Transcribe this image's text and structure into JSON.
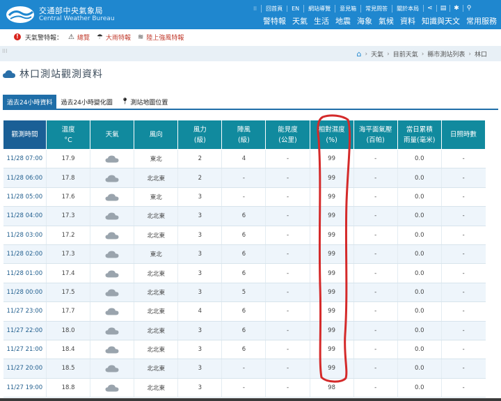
{
  "header": {
    "org_name_zh": "交通部中央氣象局",
    "org_name_en": "Central Weather Bureau",
    "top_links": [
      "回首頁",
      "EN",
      "網站導覽",
      "意見箱",
      "常見問答",
      "關於本局"
    ],
    "main_nav": [
      "警特報",
      "天氣",
      "生活",
      "地震",
      "海象",
      "氣候",
      "資料",
      "知識與天文",
      "常用服務"
    ]
  },
  "alerts": {
    "label": "天氣警特報：",
    "items": [
      {
        "icon": "warning-triangle-icon",
        "text": "總覽"
      },
      {
        "icon": "heavy-rain-icon",
        "text": "大雨特報"
      },
      {
        "icon": "strong-wind-icon",
        "text": "陸上強風特報"
      }
    ]
  },
  "breadcrumb": [
    "天氣",
    "目前天氣",
    "縣市測站列表",
    "林口"
  ],
  "page_title": "林口測站觀測資料",
  "tabs": [
    {
      "label": "過去24小時資料",
      "active": true
    },
    {
      "label": "過去24小時變化圖",
      "active": false
    },
    {
      "label": "測站地圖位置",
      "active": false
    }
  ],
  "table": {
    "columns": [
      [
        "觀測時間"
      ],
      [
        "溫度",
        "°C"
      ],
      [
        "天氣"
      ],
      [
        "風向"
      ],
      [
        "風力",
        "(級)"
      ],
      [
        "陣風",
        "(級)"
      ],
      [
        "能見度",
        "(公里)"
      ],
      [
        "相對濕度",
        "(%)"
      ],
      [
        "海平面氣壓",
        "(百帕)"
      ],
      [
        "當日累積",
        "雨量(毫米)"
      ],
      [
        "日照時數"
      ]
    ],
    "rows": [
      {
        "time": "11/28 07:00",
        "temp": "17.9",
        "weather": "cloudy-icon",
        "wind_dir": "東北",
        "wind": "2",
        "gust": "4",
        "vis": "-",
        "rh": "99",
        "pressure": "-",
        "rain": "0.0",
        "sun": "-"
      },
      {
        "time": "11/28 06:00",
        "temp": "17.8",
        "weather": "cloudy-icon",
        "wind_dir": "北北東",
        "wind": "2",
        "gust": "-",
        "vis": "-",
        "rh": "99",
        "pressure": "-",
        "rain": "0.0",
        "sun": "-"
      },
      {
        "time": "11/28 05:00",
        "temp": "17.6",
        "weather": "cloudy-icon",
        "wind_dir": "東北",
        "wind": "3",
        "gust": "-",
        "vis": "-",
        "rh": "99",
        "pressure": "-",
        "rain": "0.0",
        "sun": "-"
      },
      {
        "time": "11/28 04:00",
        "temp": "17.3",
        "weather": "cloudy-icon",
        "wind_dir": "北北東",
        "wind": "3",
        "gust": "6",
        "vis": "-",
        "rh": "99",
        "pressure": "-",
        "rain": "0.0",
        "sun": "-"
      },
      {
        "time": "11/28 03:00",
        "temp": "17.2",
        "weather": "cloudy-icon",
        "wind_dir": "北北東",
        "wind": "3",
        "gust": "6",
        "vis": "-",
        "rh": "99",
        "pressure": "-",
        "rain": "0.0",
        "sun": "-"
      },
      {
        "time": "11/28 02:00",
        "temp": "17.3",
        "weather": "cloudy-icon",
        "wind_dir": "東北",
        "wind": "3",
        "gust": "6",
        "vis": "-",
        "rh": "99",
        "pressure": "-",
        "rain": "0.0",
        "sun": "-"
      },
      {
        "time": "11/28 01:00",
        "temp": "17.4",
        "weather": "cloudy-icon",
        "wind_dir": "北北東",
        "wind": "3",
        "gust": "6",
        "vis": "-",
        "rh": "99",
        "pressure": "-",
        "rain": "0.0",
        "sun": "-"
      },
      {
        "time": "11/28 00:00",
        "temp": "17.5",
        "weather": "cloudy-icon",
        "wind_dir": "北北東",
        "wind": "3",
        "gust": "5",
        "vis": "-",
        "rh": "99",
        "pressure": "-",
        "rain": "0.0",
        "sun": "-"
      },
      {
        "time": "11/27 23:00",
        "temp": "17.7",
        "weather": "cloudy-icon",
        "wind_dir": "北北東",
        "wind": "4",
        "gust": "6",
        "vis": "-",
        "rh": "99",
        "pressure": "-",
        "rain": "0.0",
        "sun": "-"
      },
      {
        "time": "11/27 22:00",
        "temp": "18.0",
        "weather": "cloudy-icon",
        "wind_dir": "北北東",
        "wind": "3",
        "gust": "6",
        "vis": "-",
        "rh": "99",
        "pressure": "-",
        "rain": "0.0",
        "sun": "-"
      },
      {
        "time": "11/27 21:00",
        "temp": "18.4",
        "weather": "cloudy-icon",
        "wind_dir": "北北東",
        "wind": "3",
        "gust": "6",
        "vis": "-",
        "rh": "99",
        "pressure": "-",
        "rain": "0.0",
        "sun": "-"
      },
      {
        "time": "11/27 20:00",
        "temp": "18.5",
        "weather": "cloudy-icon",
        "wind_dir": "北北東",
        "wind": "3",
        "gust": "-",
        "vis": "-",
        "rh": "99",
        "pressure": "-",
        "rain": "0.0",
        "sun": "-"
      },
      {
        "time": "11/27 19:00",
        "temp": "18.8",
        "weather": "cloudy-icon",
        "wind_dir": "北北東",
        "wind": "3",
        "gust": "-",
        "vis": "-",
        "rh": "98",
        "pressure": "-",
        "rain": "0.0",
        "sun": "-"
      }
    ]
  },
  "colors": {
    "header_bg": "#1f87cf",
    "table_header": "#118a9e",
    "table_header_first": "#1a5f96",
    "annotation": "#d42a2a"
  }
}
